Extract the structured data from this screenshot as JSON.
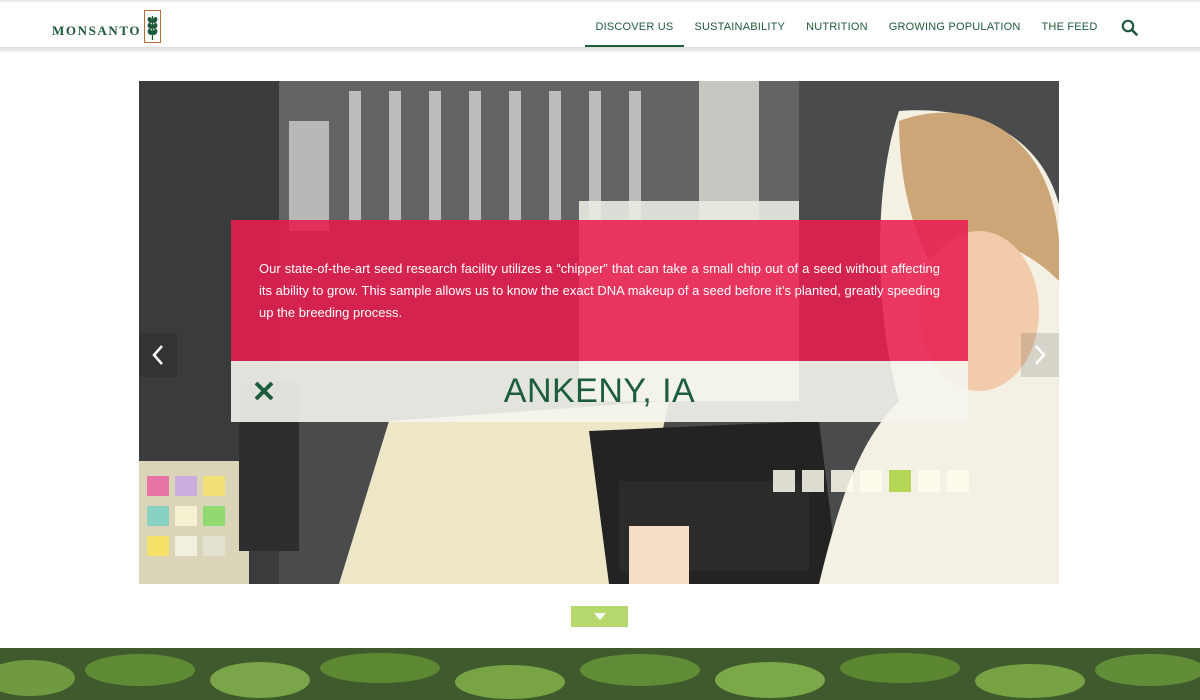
{
  "brand": {
    "name": "MONSANTO",
    "logo_icon": "wheat-icon",
    "color": "#1d5a3a"
  },
  "nav": {
    "items": [
      {
        "label": "DISCOVER US",
        "active": true
      },
      {
        "label": "SUSTAINABILITY",
        "active": false
      },
      {
        "label": "NUTRITION",
        "active": false
      },
      {
        "label": "GROWING POPULATION",
        "active": false
      },
      {
        "label": "THE FEED",
        "active": false
      }
    ],
    "search_icon": "search-icon"
  },
  "slide": {
    "caption": "Our state-of-the-art seed research facility utilizes a “chipper” that can take a small chip out of a seed without affecting its ability to grow. This sample allows us to know the exact DNA makeup of a seed before it’s planted, greatly speeding up the breeding process.",
    "location": "ANKENY, IA",
    "close_icon": "close-icon",
    "prev_icon": "chevron-left-icon",
    "next_icon": "chevron-right-icon",
    "slide_count": 7,
    "active_index": 4
  },
  "scroll_down_icon": "caret-down-icon",
  "colors": {
    "accent": "#1b5e3b",
    "caption_bg": "#e81e50",
    "active_dot": "#b5d655",
    "scroll_button": "#b7d86c"
  }
}
